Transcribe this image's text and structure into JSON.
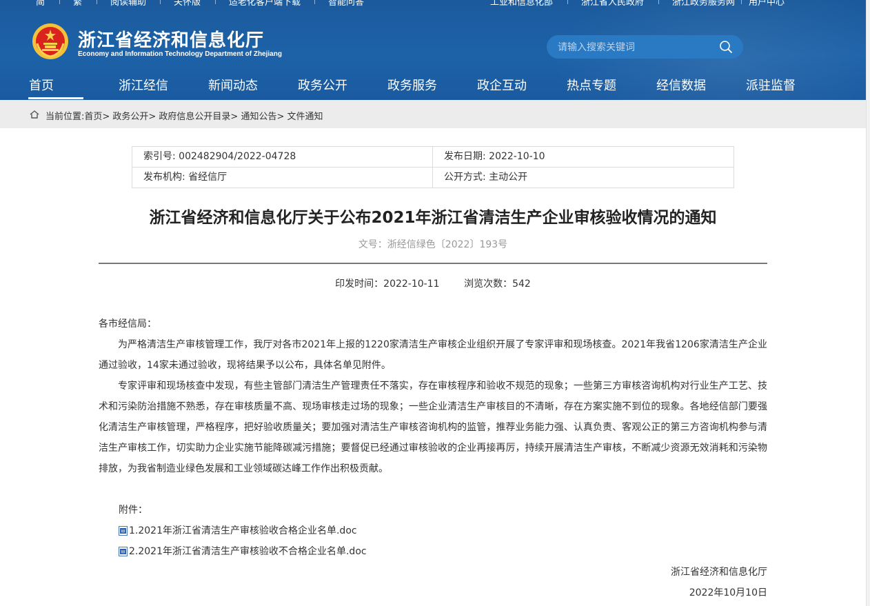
{
  "topbar": {
    "left_items": [
      "简",
      "繁",
      "阅读辅助",
      "关怀版",
      "适老化客户端下载",
      "智能问答"
    ],
    "right_items": [
      "工业和信息化部",
      "浙江省人民政府",
      "浙江政务服务网",
      "用户中心"
    ]
  },
  "site": {
    "title": "浙江省经济和信息化厅",
    "subtitle": "Economy and Information Technology Department of Zhejiang"
  },
  "search": {
    "placeholder": "请输入搜索关键词"
  },
  "nav": {
    "items": [
      "首页",
      "浙江经信",
      "新闻动态",
      "政务公开",
      "政务服务",
      "政企互动",
      "热点专题",
      "经信数据",
      "派驻监督"
    ],
    "active_index": 0
  },
  "breadcrumb": {
    "text": "当前位置:首页> 政务公开> 政府信息公开目录> 通知公告> 文件通知"
  },
  "meta": {
    "index_no": "索引号: 002482904/2022-04728",
    "publish_date": "发布日期: 2022-10-10",
    "publisher": "发布机构: 省经信厅",
    "disclosure": "公开方式: 主动公开"
  },
  "article": {
    "title": "浙江省经济和信息化厅关于公布2021年浙江省清洁生产企业审核验收情况的通知",
    "doc_number": "文号：浙经信绿色〔2022〕193号",
    "pub_info": "印发时间：2022-10-11        浏览次数：542",
    "salutation": "各市经信局：",
    "paragraphs": [
      "为严格清洁生产审核管理工作，我厅对各市2021年上报的1220家清洁生产审核企业组织开展了专家评审和现场核查。2021年我省1206家清洁生产企业通过验收，14家未通过验收，现将结果予以公布，具体名单见附件。",
      "专家评审和现场核查中发现，有些主管部门清洁生产管理责任不落实，存在审核程序和验收不规范的现象；一些第三方审核咨询机构对行业生产工艺、技术和污染防治措施不熟悉，存在审核质量不高、现场审核走过场的现象；一些企业清洁生产审核目的不清晰，存在方案实施不到位的现象。各地经信部门要强化清洁生产审核管理，严格程序，把好验收质量关；要加强对清洁生产审核咨询机构的监管，推荐业务能力强、认真负责、客观公正的第三方咨询机构参与清洁生产审核工作，切实助力企业实施节能降碳减污措施；要督促已经通过审核验收的企业再接再厉，持续开展清洁生产审核，不断减少资源无效消耗和污染物排放，为我省制造业绿色发展和工业领域碳达峰工作作出积极贡献。"
    ],
    "attachments_label": "附件：",
    "attachments": [
      "1.2021年浙江省清洁生产审核验收合格企业名单.doc",
      "2.2021年浙江省清洁生产审核验收不合格企业名单.doc"
    ],
    "signature_org": "浙江省经济和信息化厅",
    "signature_date": "2022年10月10日"
  },
  "colors": {
    "header_bg": "#1d62a8",
    "breadcrumb_bg": "#ececec",
    "search_bg": "#2a79c3"
  },
  "icons": [
    "emblem-icon",
    "search-icon",
    "home-icon",
    "wechat-icon",
    "doc-icon"
  ]
}
